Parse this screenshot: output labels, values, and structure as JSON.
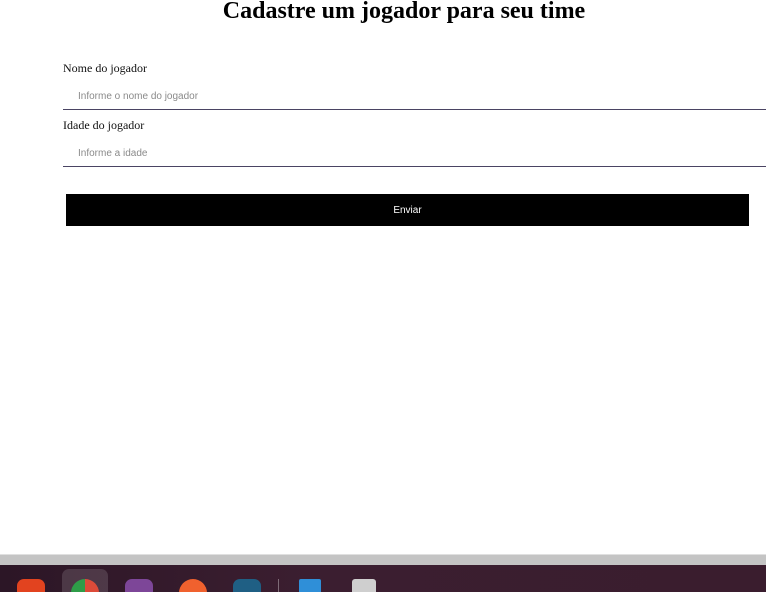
{
  "form": {
    "title": "Cadastre um jogador para seu time",
    "fields": [
      {
        "label": "Nome do jogador",
        "placeholder": "Informe o nome do jogador",
        "value": ""
      },
      {
        "label": "Idade do jogador",
        "placeholder": "Informe a idade",
        "value": ""
      }
    ],
    "submit_label": "Enviar"
  },
  "taskbar": {
    "apps": [
      {
        "icon": "brave-browser-icon",
        "color": "#e2431f",
        "active": false
      },
      {
        "icon": "chrome-browser-icon",
        "color": "#dd4b39",
        "active": true
      },
      {
        "icon": "tor-browser-icon",
        "color": "#7d4698",
        "active": false
      },
      {
        "icon": "postman-icon",
        "color": "#f0612e",
        "active": false
      },
      {
        "icon": "mysql-workbench-icon",
        "color": "#1f5f84",
        "active": false
      },
      {
        "icon": "libreoffice-writer-icon",
        "color": "#2f8fd8",
        "active": false
      },
      {
        "icon": "files-icon",
        "color": "#cfcfcf",
        "active": false
      }
    ]
  }
}
